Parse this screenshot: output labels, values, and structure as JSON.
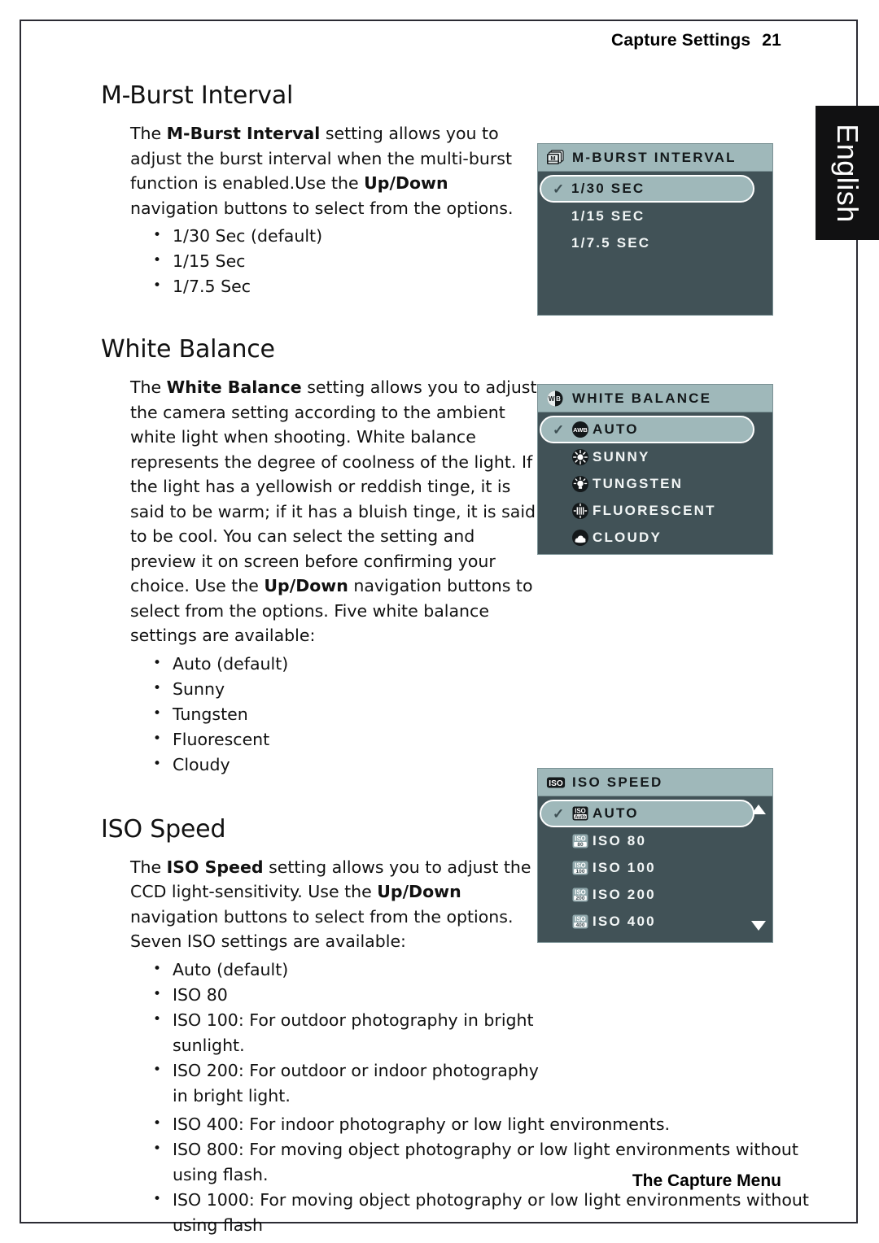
{
  "header": {
    "title": "Capture Settings",
    "page_number": "21"
  },
  "footer": {
    "text": "The Capture Menu"
  },
  "language_tab": {
    "label": "English"
  },
  "sections": {
    "mburst": {
      "heading": "M-Burst Interval",
      "para_pre": "The ",
      "para_bold1": "M-Burst Interval",
      "para_mid": " setting allows you to adjust the burst interval when the multi-burst function is enabled.Use the ",
      "para_bold2": "Up/Down",
      "para_post": " navigation buttons to select from the options.",
      "bullets": [
        "1/30 Sec (default)",
        "1/15 Sec",
        "1/7.5 Sec"
      ]
    },
    "white_balance": {
      "heading": "White Balance",
      "para_pre": "The ",
      "para_bold1": "White Balance",
      "para_mid": " setting allows you to adjust the camera setting according to the ambient white light when shooting. White balance represents the degree of coolness of the light. If the light has a yellowish or reddish tinge, it is said to be warm; if it has a bluish tinge, it is said to be cool. You can select the setting and preview it on screen before confirming your choice. Use the ",
      "para_bold2": "Up/Down",
      "para_post": " navigation buttons to select from the options. Five white balance settings are available:",
      "bullets": [
        "Auto (default)",
        "Sunny",
        "Tungsten",
        "Fluorescent",
        "Cloudy"
      ]
    },
    "iso": {
      "heading": "ISO Speed",
      "para_pre": "The ",
      "para_bold1": "ISO Speed",
      "para_mid": " setting allows you to adjust the CCD light-sensitivity. Use the ",
      "para_bold2": "Up/Down",
      "para_post": " navigation buttons to select from the options. Seven ISO settings are available:",
      "bullets_narrow": [
        "Auto (default)",
        "ISO 80",
        "ISO 100: For outdoor photography in bright sunlight.",
        "ISO 200: For outdoor or indoor photography in bright light."
      ],
      "bullets_wide": [
        "ISO 400: For indoor photography or low light environments.",
        "ISO 800: For moving object photography or low light environments without using flash.",
        "ISO 1000: For moving object photography or low light environments without using flash"
      ]
    }
  },
  "lcd_menus": {
    "mburst": {
      "title": "M-BURST INTERVAL",
      "title_icon": "multi-burst-icon",
      "rows": [
        {
          "label": "1/30 SEC",
          "selected": true,
          "check": "✓"
        },
        {
          "label": "1/15 SEC",
          "selected": false
        },
        {
          "label": "1/7.5 SEC",
          "selected": false
        }
      ]
    },
    "white_balance": {
      "title": "WHITE BALANCE",
      "title_icon": "wb-icon",
      "rows": [
        {
          "label": "AUTO",
          "icon": "awb-icon",
          "selected": true,
          "check": "✓"
        },
        {
          "label": "SUNNY",
          "icon": "sun-icon",
          "selected": false
        },
        {
          "label": "TUNGSTEN",
          "icon": "tungsten-icon",
          "selected": false
        },
        {
          "label": "FLUORESCENT",
          "icon": "fluorescent-icon",
          "selected": false
        },
        {
          "label": "CLOUDY",
          "icon": "cloud-icon",
          "selected": false
        }
      ]
    },
    "iso": {
      "title": "ISO SPEED",
      "title_icon": "iso-icon",
      "scroll_up": "▲",
      "scroll_down": "▼",
      "rows": [
        {
          "label": "AUTO",
          "icon_top": "ISO",
          "icon_bottom": "Auto",
          "selected": true,
          "check": "✓"
        },
        {
          "label": "ISO 80",
          "icon_top": "ISO",
          "icon_bottom": "80",
          "selected": false
        },
        {
          "label": "ISO 100",
          "icon_top": "ISO",
          "icon_bottom": "100",
          "selected": false
        },
        {
          "label": "ISO 200",
          "icon_top": "ISO",
          "icon_bottom": "200",
          "selected": false
        },
        {
          "label": "ISO 400",
          "icon_top": "ISO",
          "icon_bottom": "400",
          "selected": false
        }
      ]
    }
  },
  "colors": {
    "lcd_body": "#415257",
    "lcd_title_bar": "#9fb8ba",
    "lcd_selected": "#9fb8ba",
    "tab_background": "#111112",
    "page_border": "#2b2b33"
  }
}
